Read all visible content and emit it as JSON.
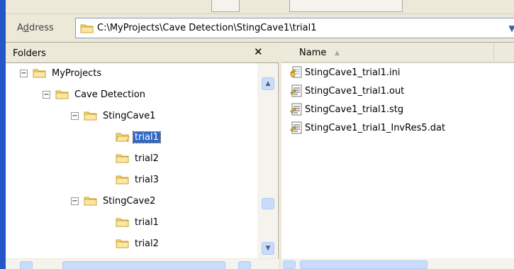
{
  "address": {
    "label": "Address",
    "path": "C:\\MyProjects\\Cave Detection\\StingCave1\\trial1"
  },
  "folders_pane": {
    "title": "Folders",
    "close_symbol": "✕",
    "tree": [
      {
        "label": "MyProjects",
        "expander": "⊟"
      },
      {
        "label": "Cave Detection",
        "expander": "⊟"
      },
      {
        "label": "StingCave1",
        "expander": "⊟"
      },
      {
        "label": "trial1",
        "selected": true
      },
      {
        "label": "trial2"
      },
      {
        "label": "trial3"
      },
      {
        "label": "StingCave2",
        "expander": "⊟"
      },
      {
        "label": "trial1"
      },
      {
        "label": "trial2"
      }
    ]
  },
  "files_pane": {
    "column_header": "Name",
    "sort_indicator": "▲",
    "files": [
      {
        "name": "StingCave1_trial1.ini",
        "icon": "ini-settings-icon"
      },
      {
        "name": "StingCave1_trial1.out",
        "icon": "text-document-icon"
      },
      {
        "name": "StingCave1_trial1.stg",
        "icon": "text-document-icon"
      },
      {
        "name": "StingCave1_trial1_InvRes5.dat",
        "icon": "text-document-icon"
      }
    ]
  },
  "colors": {
    "selection": "#316ac5",
    "folder_yellow": "#f6d66b",
    "scrollbar": "#c9dcfb",
    "window_frame": "#2456c8"
  }
}
